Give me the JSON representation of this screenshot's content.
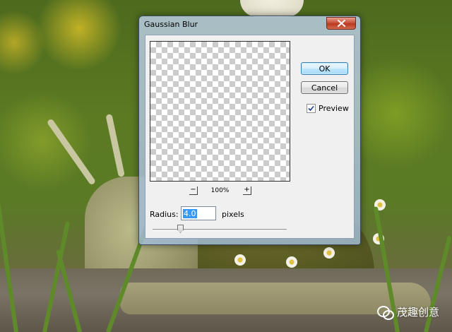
{
  "dialog": {
    "title": "Gaussian Blur",
    "ok_label": "OK",
    "cancel_label": "Cancel",
    "preview_label": "Preview",
    "preview_checked": true,
    "zoom_out_label": "−",
    "zoom_in_label": "+",
    "zoom_level": "100%",
    "radius_label": "Radius:",
    "radius_value": "4.0",
    "radius_units": "pixels",
    "close_icon": "close-icon",
    "accent_color": "#3399ff"
  },
  "watermark": {
    "text": "茂趣创意",
    "icon": "wechat-icon"
  }
}
